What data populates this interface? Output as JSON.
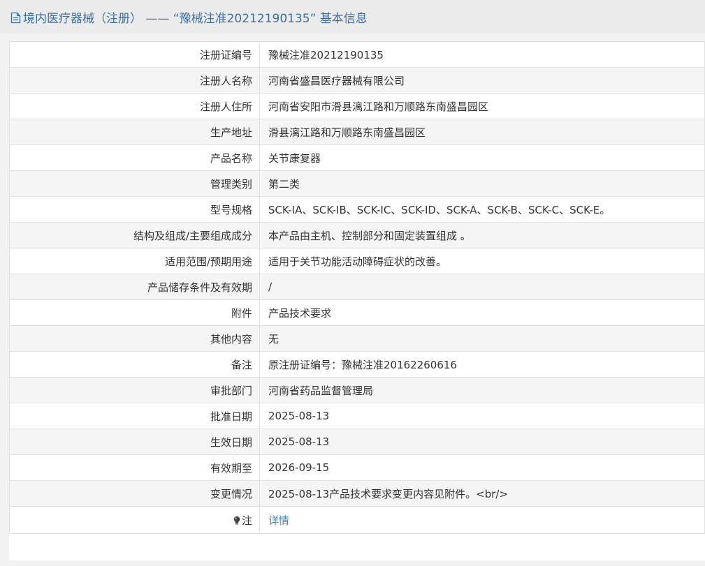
{
  "header": {
    "title": "境内医疗器械（注册） ——  “豫械注准20212190135” 基本信息",
    "title_icon": "document-icon",
    "title_color": "#3d6fa4"
  },
  "rows": [
    {
      "label": "注册证编号",
      "value": "豫械注准20212190135"
    },
    {
      "label": "注册人名称",
      "value": "河南省盛昌医疗器械有限公司"
    },
    {
      "label": "注册人住所",
      "value": "河南省安阳市滑县漓江路和万顺路东南盛昌园区"
    },
    {
      "label": "生产地址",
      "value": "滑县漓江路和万顺路东南盛昌园区"
    },
    {
      "label": "产品名称",
      "value": "关节康复器"
    },
    {
      "label": "管理类别",
      "value": "第二类"
    },
    {
      "label": "型号规格",
      "value": "SCK-ⅠA、SCK-ⅠB、SCK-ⅠC、SCK-ⅠD、SCK-A、SCK-B、SCK-C、SCK-E。"
    },
    {
      "label": "结构及组成/主要组成成分",
      "value": "本产品由主机、控制部分和固定装置组成 。"
    },
    {
      "label": "适用范围/预期用途",
      "value": "适用于关节功能活动障碍症状的改善。"
    },
    {
      "label": "产品储存条件及有效期",
      "value": "/"
    },
    {
      "label": "附件",
      "value": "产品技术要求"
    },
    {
      "label": "其他内容",
      "value": "无"
    },
    {
      "label": "备注",
      "value": "原注册证编号：豫械注准20162260616"
    },
    {
      "label": "审批部门",
      "value": "河南省药品监督管理局"
    },
    {
      "label": "批准日期",
      "value": "2025-08-13"
    },
    {
      "label": "生效日期",
      "value": "2025-08-13"
    },
    {
      "label": "有效期至",
      "value": "2026-09-15"
    },
    {
      "label": "变更情况",
      "value": "2025-08-13产品技术要求变更内容见附件。<br/>"
    }
  ],
  "note": {
    "label": "注",
    "icon": "lightbulb-icon",
    "link_text": "详情",
    "link_color": "#3d84c6"
  }
}
